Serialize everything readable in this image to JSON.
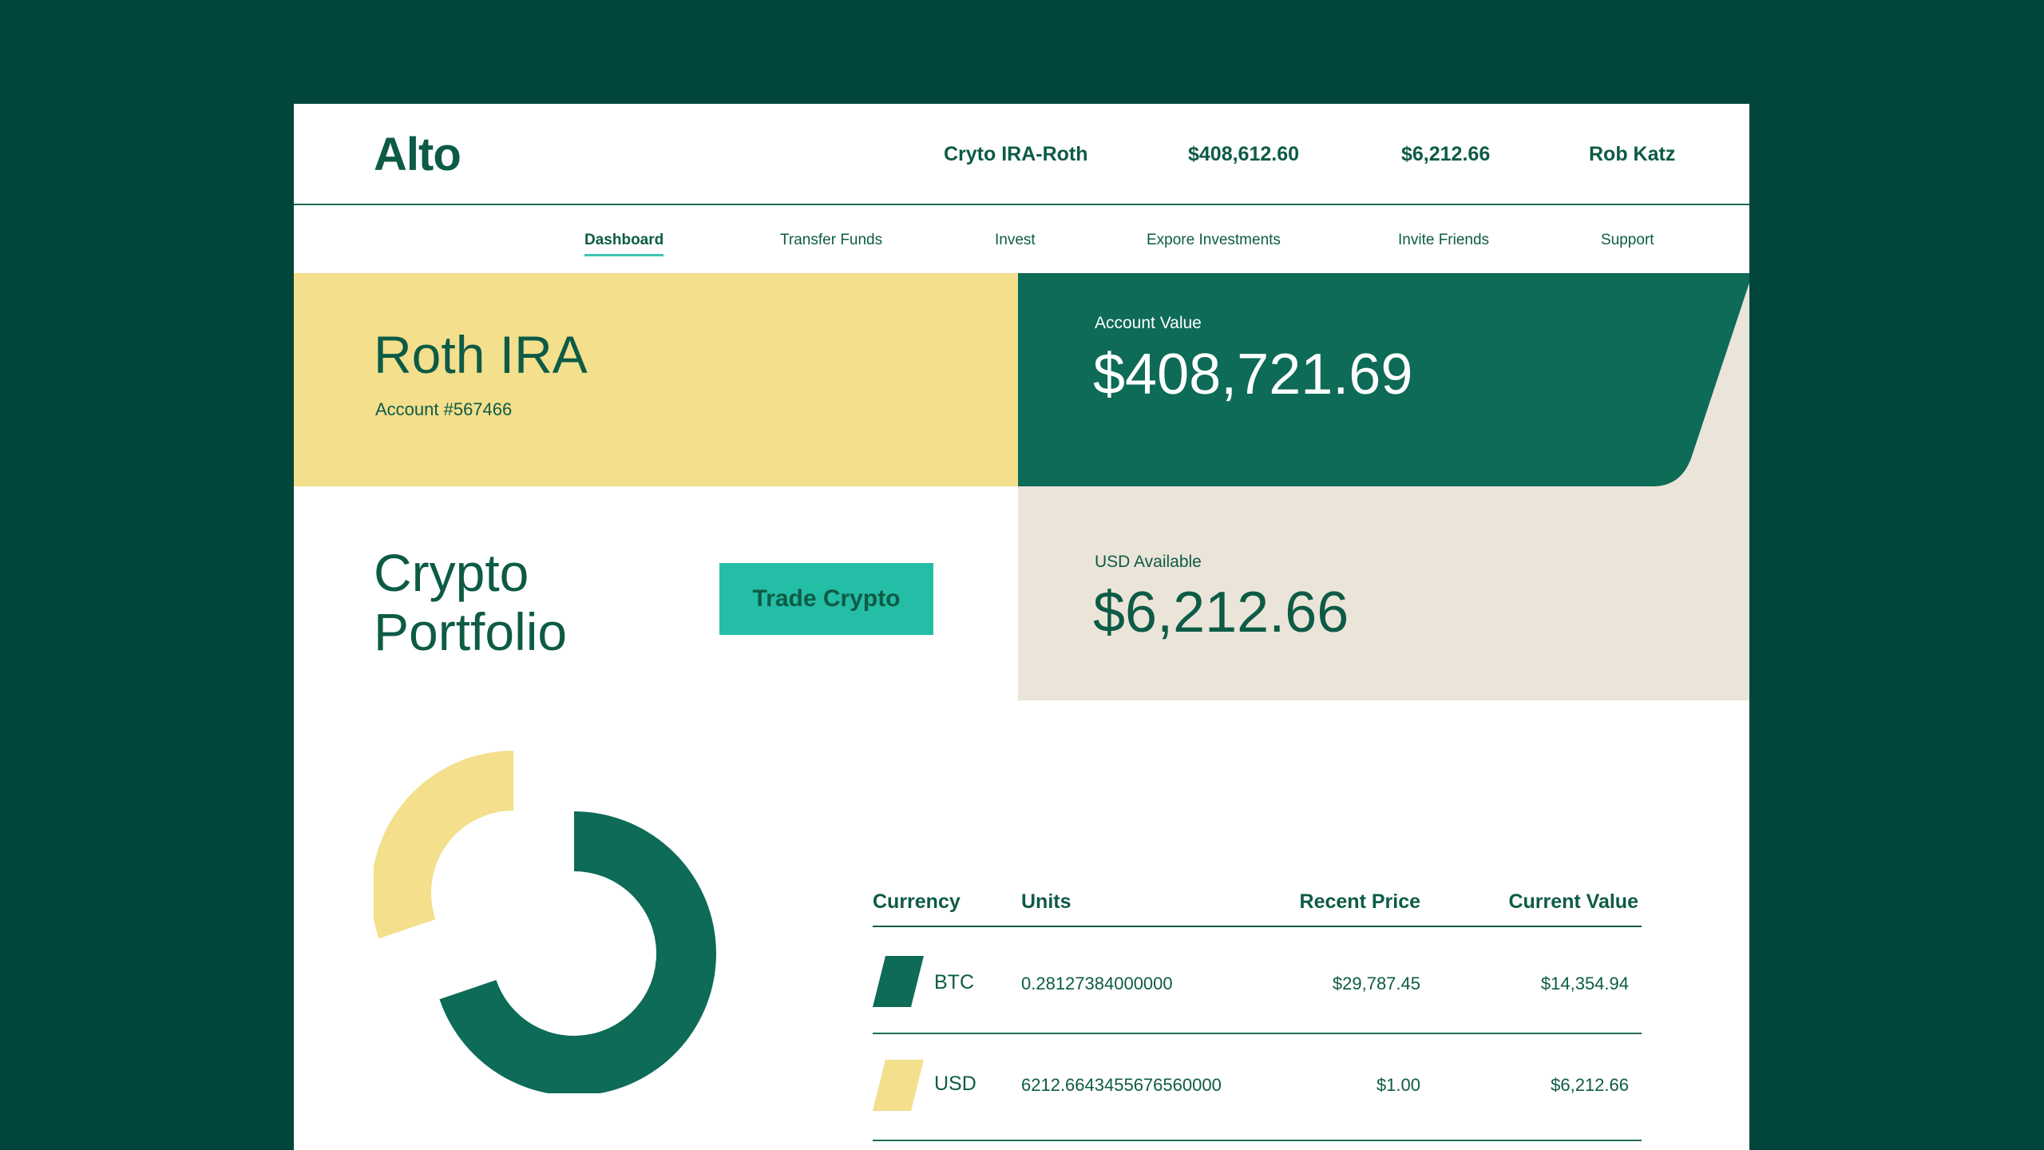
{
  "header": {
    "logo": "Alto",
    "account_name": "Cryto IRA-Roth",
    "total_value": "$408,612.60",
    "usd_value": "$6,212.66",
    "user_name": "Rob Katz"
  },
  "nav": {
    "items": [
      {
        "label": "Dashboard",
        "active": true
      },
      {
        "label": "Transfer Funds"
      },
      {
        "label": "Invest"
      },
      {
        "label": "Expore Investments"
      },
      {
        "label": "Invite Friends"
      },
      {
        "label": "Support"
      }
    ]
  },
  "account": {
    "title": "Roth IRA",
    "number": "Account #567466",
    "value_label": "Account Value",
    "value": "$408,721.69",
    "usd_label": "USD Available",
    "usd_value": "$6,212.66"
  },
  "portfolio": {
    "title_line1": "Crypto",
    "title_line2": "Portfolio",
    "trade_button": "Trade Crypto"
  },
  "holdings": {
    "columns": [
      "Currency",
      "Units",
      "Recent Price",
      "Current Value"
    ],
    "rows": [
      {
        "currency": "BTC",
        "units": "0.28127384000000",
        "recent_price": "$29,787.45",
        "current_value": "$14,354.94",
        "color": "#0d6b58"
      },
      {
        "currency": "USD",
        "units": "6212.6643455676560000",
        "recent_price": "$1.00",
        "current_value": "$6,212.66",
        "color": "#f3df8c"
      }
    ]
  },
  "colors": {
    "background": "#02463b",
    "primary_green": "#0d6b58",
    "yellow": "#f3df8c",
    "teal_button": "#24bda6",
    "beige": "#ebe4d9"
  },
  "chart_data": {
    "type": "pie",
    "categories": [
      "BTC",
      "USD"
    ],
    "values": [
      14354.94,
      6212.66
    ],
    "colors": [
      "#0d6b58",
      "#f3df8c"
    ]
  }
}
